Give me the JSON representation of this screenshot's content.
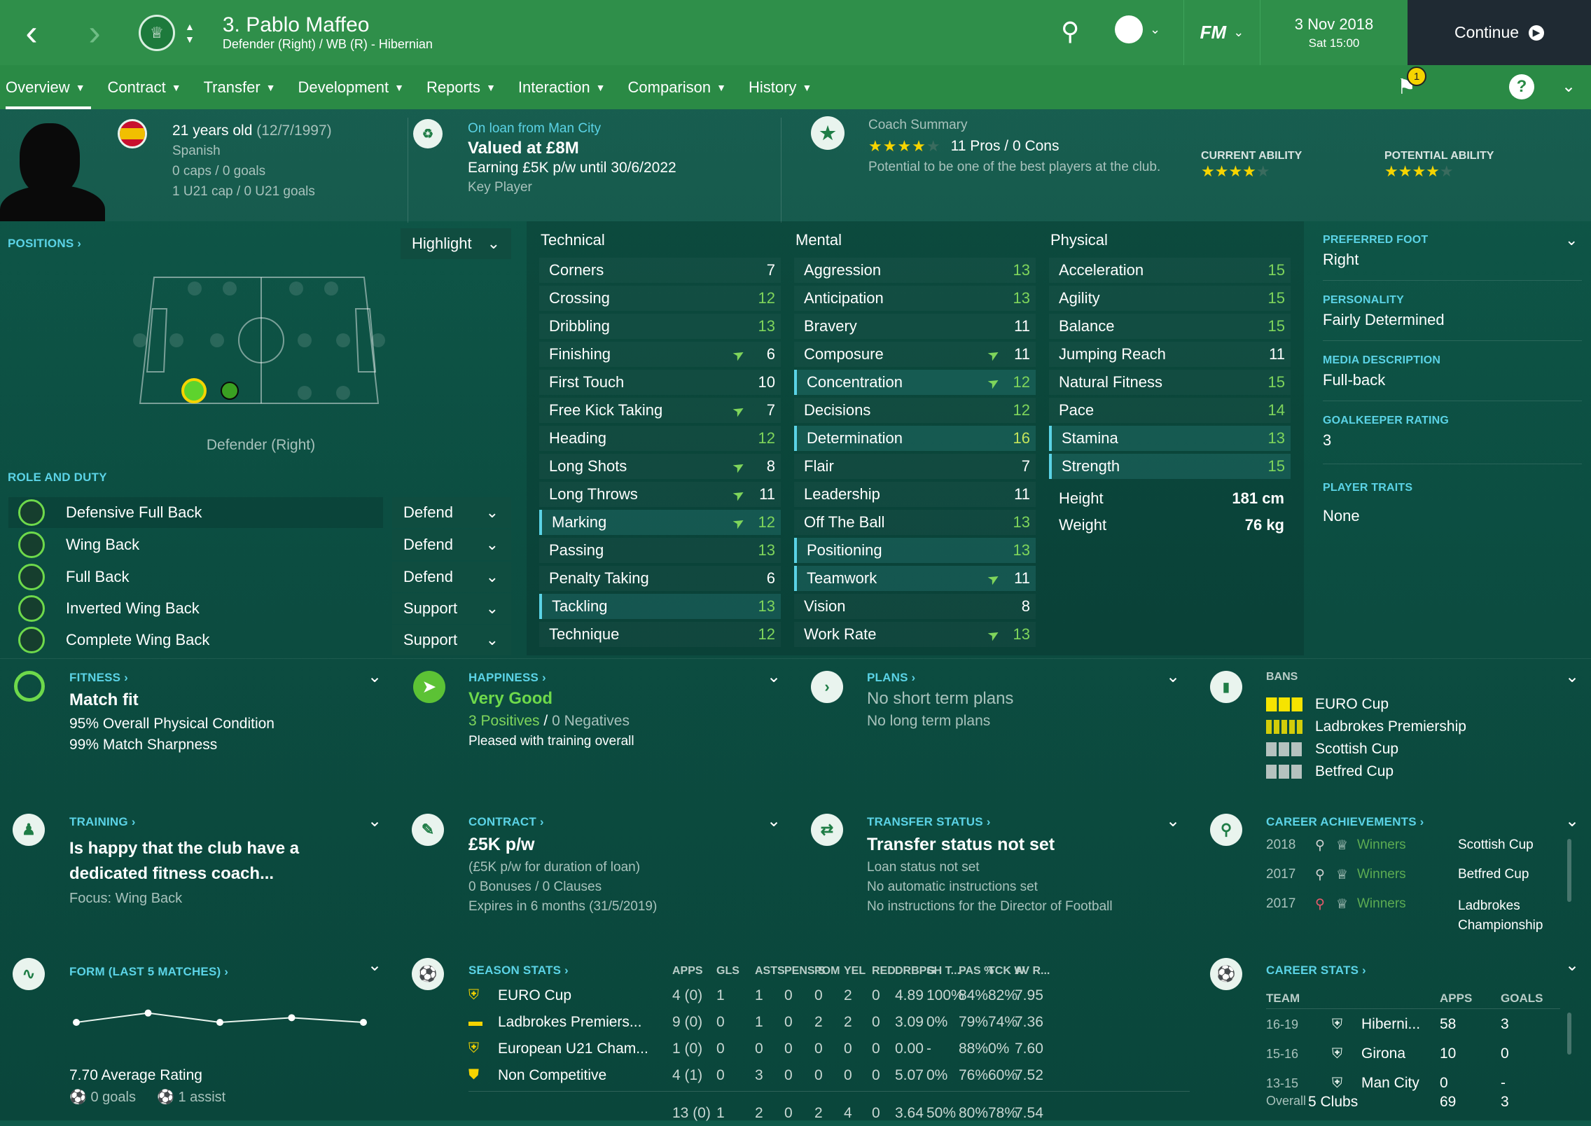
{
  "header": {
    "player_title": "3. Pablo Maffeo",
    "player_sub": "Defender (Right) / WB (R) - Hibernian",
    "date": "3 Nov 2018",
    "time": "Sat 15:00",
    "continue": "Continue",
    "fm": "FM"
  },
  "menu": [
    {
      "label": "Overview"
    },
    {
      "label": "Contract"
    },
    {
      "label": "Transfer"
    },
    {
      "label": "Development"
    },
    {
      "label": "Reports"
    },
    {
      "label": "Interaction"
    },
    {
      "label": "Comparison"
    },
    {
      "label": "History"
    }
  ],
  "notif_count": "1",
  "profile": {
    "age": "21 years old",
    "dob": "(12/7/1997)",
    "nation": "Spanish",
    "caps": "0 caps / 0 goals",
    "u21": "1 U21 cap / 0 U21 goals"
  },
  "loan": {
    "from": "On loan from Man City",
    "value": "Valued at £8M",
    "earning": "Earning £5K p/w until 30/6/2022",
    "status": "Key Player"
  },
  "coach": {
    "title": "Coach Summary",
    "pros": "11 Pros / 0 Cons",
    "potential": "Potential to be one of the best players at the club.",
    "stars": 4,
    "ca_label": "CURRENT ABILITY",
    "pa_label": "POTENTIAL ABILITY",
    "ca_stars": 4,
    "pa_stars": 4
  },
  "positions": {
    "label": "POSITIONS",
    "highlight": "Highlight",
    "position_name": "Defender (Right)"
  },
  "roles": {
    "label": "ROLE AND DUTY",
    "items": [
      {
        "role": "Defensive Full Back",
        "duty": "Defend"
      },
      {
        "role": "Wing Back",
        "duty": "Defend"
      },
      {
        "role": "Full Back",
        "duty": "Defend"
      },
      {
        "role": "Inverted Wing Back",
        "duty": "Support"
      },
      {
        "role": "Complete Wing Back",
        "duty": "Support"
      }
    ]
  },
  "attributes": {
    "technical_title": "Technical",
    "mental_title": "Mental",
    "physical_title": "Physical",
    "technical": [
      {
        "n": "Corners",
        "v": "7"
      },
      {
        "n": "Crossing",
        "v": "12"
      },
      {
        "n": "Dribbling",
        "v": "13"
      },
      {
        "n": "Finishing",
        "v": "6",
        "up": true
      },
      {
        "n": "First Touch",
        "v": "10"
      },
      {
        "n": "Free Kick Taking",
        "v": "7",
        "up": true
      },
      {
        "n": "Heading",
        "v": "12"
      },
      {
        "n": "Long Shots",
        "v": "8",
        "up": true
      },
      {
        "n": "Long Throws",
        "v": "11",
        "up": true
      },
      {
        "n": "Marking",
        "v": "12",
        "up": true,
        "hl": true
      },
      {
        "n": "Passing",
        "v": "13"
      },
      {
        "n": "Penalty Taking",
        "v": "6"
      },
      {
        "n": "Tackling",
        "v": "13",
        "hl": true
      },
      {
        "n": "Technique",
        "v": "12"
      }
    ],
    "mental": [
      {
        "n": "Aggression",
        "v": "13"
      },
      {
        "n": "Anticipation",
        "v": "13"
      },
      {
        "n": "Bravery",
        "v": "11"
      },
      {
        "n": "Composure",
        "v": "11",
        "up": true
      },
      {
        "n": "Concentration",
        "v": "12",
        "up": true,
        "hl": true
      },
      {
        "n": "Decisions",
        "v": "12"
      },
      {
        "n": "Determination",
        "v": "16",
        "hl": true
      },
      {
        "n": "Flair",
        "v": "7"
      },
      {
        "n": "Leadership",
        "v": "11"
      },
      {
        "n": "Off The Ball",
        "v": "13"
      },
      {
        "n": "Positioning",
        "v": "13",
        "hl": true
      },
      {
        "n": "Teamwork",
        "v": "11",
        "up": true,
        "hl": true
      },
      {
        "n": "Vision",
        "v": "8"
      },
      {
        "n": "Work Rate",
        "v": "13",
        "up": true
      }
    ],
    "physical": [
      {
        "n": "Acceleration",
        "v": "15"
      },
      {
        "n": "Agility",
        "v": "15"
      },
      {
        "n": "Balance",
        "v": "15"
      },
      {
        "n": "Jumping Reach",
        "v": "11"
      },
      {
        "n": "Natural Fitness",
        "v": "15"
      },
      {
        "n": "Pace",
        "v": "14"
      },
      {
        "n": "Stamina",
        "v": "13",
        "hl": true
      },
      {
        "n": "Strength",
        "v": "15",
        "hl": true
      }
    ],
    "height_label": "Height",
    "height": "181 cm",
    "weight_label": "Weight",
    "weight": "76 kg"
  },
  "info": {
    "foot_label": "PREFERRED FOOT",
    "foot": "Right",
    "personality_label": "PERSONALITY",
    "personality": "Fairly Determined",
    "media_label": "MEDIA DESCRIPTION",
    "media": "Full-back",
    "gk_label": "GOALKEEPER RATING",
    "gk": "3",
    "traits_label": "PLAYER TRAITS",
    "traits": "None"
  },
  "fitness": {
    "label": "FITNESS",
    "title": "Match fit",
    "l1": "95% Overall Physical Condition",
    "l2": "99% Match Sharpness"
  },
  "happiness": {
    "label": "HAPPINESS",
    "title": "Very Good",
    "positives": "3 Positives",
    "sep": "/",
    "negatives": "0 Negatives",
    "note": "Pleased with training overall"
  },
  "plans": {
    "label": "PLANS",
    "title": "No short term plans",
    "sub": "No long term plans"
  },
  "bans": {
    "label": "BANS",
    "items": [
      "EURO Cup",
      "Ladbrokes Premiership",
      "Scottish Cup",
      "Betfred Cup"
    ]
  },
  "training": {
    "label": "TRAINING",
    "title": "Is happy that the club have a dedicated fitness coach...",
    "focus": "Focus: Wing Back"
  },
  "contract": {
    "label": "CONTRACT",
    "title": "£5K p/w",
    "l1": "(£5K p/w for duration of loan)",
    "l2": "0 Bonuses / 0 Clauses",
    "l3": "Expires in 6 months",
    "l3b": "(31/5/2019)"
  },
  "transfer": {
    "label": "TRANSFER STATUS",
    "title": "Transfer status not set",
    "l1": "Loan status not set",
    "l2": "No automatic instructions set",
    "l3": "No instructions for the Director of Football"
  },
  "achievements": {
    "label": "CAREER ACHIEVEMENTS",
    "items": [
      {
        "year": "2018",
        "result": "Winners",
        "comp": "Scottish Cup"
      },
      {
        "year": "2017",
        "result": "Winners",
        "comp": "Betfred Cup"
      },
      {
        "year": "2017",
        "result": "Winners",
        "comp": "Ladbrokes Championship"
      }
    ]
  },
  "form": {
    "label": "FORM (LAST 5 MATCHES)",
    "avg": "7.70 Average Rating",
    "goals": "0 goals",
    "assists": "1 assist",
    "ratings": [
      7.6,
      7.8,
      7.6,
      7.7,
      7.6
    ]
  },
  "season": {
    "label": "SEASON STATS",
    "headers": [
      "APPS",
      "GLS",
      "ASTS",
      "PENS S",
      "POM",
      "YEL",
      "RED",
      "DRBPG",
      "SH T...",
      "PAS %",
      "TCK W",
      "AV R..."
    ],
    "rows": [
      {
        "comp": "EURO Cup",
        "vals": [
          "4 (0)",
          "1",
          "1",
          "0",
          "0",
          "2",
          "0",
          "4.89",
          "100%",
          "84%",
          "82%",
          "7.95"
        ]
      },
      {
        "comp": "Ladbrokes Premiers...",
        "vals": [
          "9 (0)",
          "0",
          "1",
          "0",
          "2",
          "2",
          "0",
          "3.09",
          "0%",
          "79%",
          "74%",
          "7.36"
        ]
      },
      {
        "comp": "European U21 Cham...",
        "vals": [
          "1 (0)",
          "0",
          "0",
          "0",
          "0",
          "0",
          "0",
          "0.00",
          "-",
          "88%",
          "0%",
          "7.60"
        ]
      },
      {
        "comp": "Non Competitive",
        "vals": [
          "4 (1)",
          "0",
          "3",
          "0",
          "0",
          "0",
          "0",
          "5.07",
          "0%",
          "76%",
          "60%",
          "7.52"
        ]
      }
    ],
    "total": [
      "13 (0)",
      "1",
      "2",
      "0",
      "2",
      "4",
      "0",
      "3.64",
      "50%",
      "80%",
      "78%",
      "7.54"
    ]
  },
  "career": {
    "label": "CAREER STATS",
    "team_hdr": "TEAM",
    "apps_hdr": "APPS",
    "goals_hdr": "GOALS",
    "rows": [
      {
        "season": "16-19",
        "team": "Hiberni...",
        "apps": "58",
        "goals": "3"
      },
      {
        "season": "15-16",
        "team": "Girona",
        "apps": "10",
        "goals": "0"
      },
      {
        "season": "13-15",
        "team": "Man City",
        "apps": "0",
        "goals": "-"
      }
    ],
    "overall_label": "Overall",
    "overall_team": "5 Clubs",
    "overall_apps": "69",
    "overall_goals": "3"
  }
}
